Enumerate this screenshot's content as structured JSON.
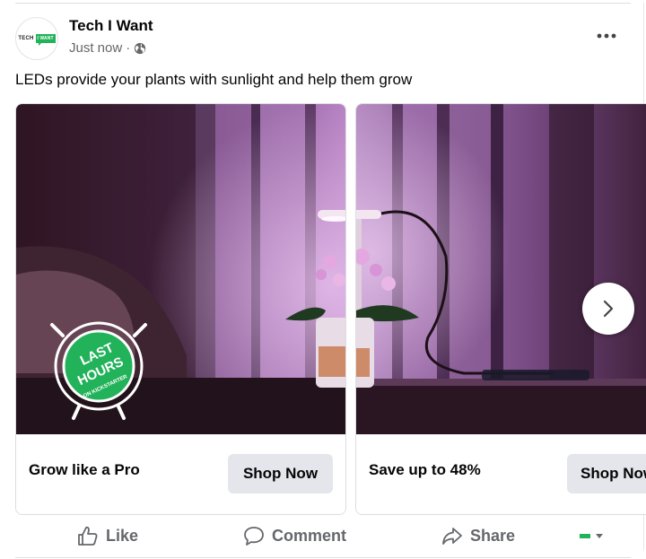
{
  "post": {
    "page_name": "Tech I Want",
    "timestamp": "Just now",
    "separator": "·",
    "audience_icon": "globe-icon",
    "caption": "LEDs provide your plants with sunlight and help them grow",
    "logo": {
      "part1": "TECH",
      "part2": "I WANT"
    }
  },
  "carousel": {
    "cards": [
      {
        "title": "Grow like a Pro",
        "cta": "Shop Now",
        "badge": {
          "line1": "LAST",
          "line2": "HOURS",
          "line3": "ON KICKSTARTER"
        }
      },
      {
        "title": "Save up to 48%",
        "cta": "Shop Now"
      }
    ],
    "next_icon": "chevron-right-icon"
  },
  "actions": {
    "like": "Like",
    "comment": "Comment",
    "share": "Share"
  },
  "colors": {
    "brand_green": "#22b25a",
    "text_primary": "#050505",
    "text_secondary": "#65676b",
    "button_bg": "#e4e6eb"
  }
}
